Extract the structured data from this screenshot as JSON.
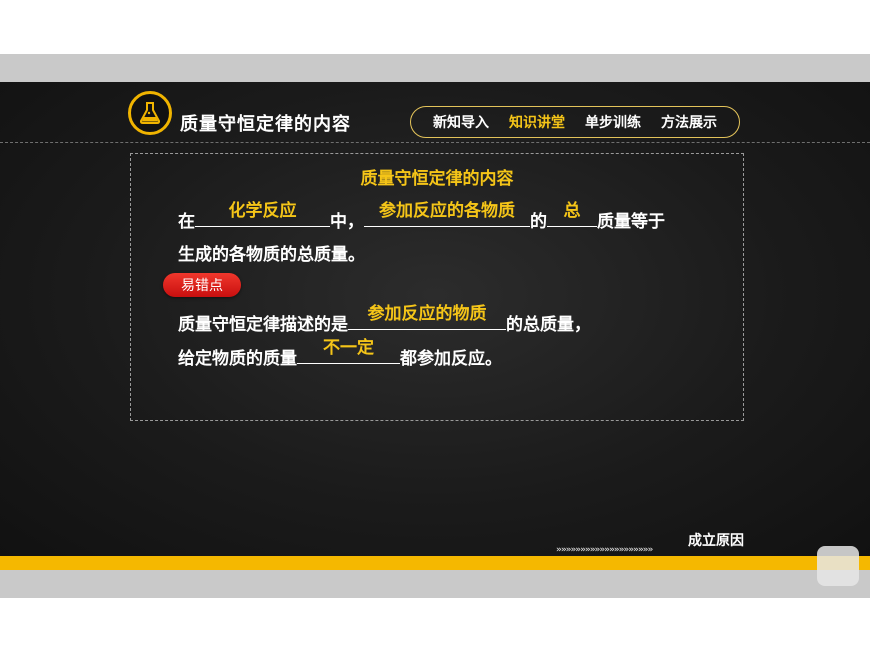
{
  "header": {
    "title": "质量守恒定律的内容",
    "logo_icon": "flask-icon"
  },
  "nav": {
    "items": [
      {
        "label": "新知导入",
        "active": false
      },
      {
        "label": "知识讲堂",
        "active": true
      },
      {
        "label": "单步训练",
        "active": false
      },
      {
        "label": "方法展示",
        "active": false
      }
    ]
  },
  "content": {
    "box_title": "质量守恒定律的内容",
    "definition": {
      "p1": "在",
      "blank1": "化学反应",
      "p2": "中，",
      "blank2": "参加反应的各物质",
      "p3": "的",
      "blank3": "总",
      "p4": "质量等于",
      "line2": "生成的各物质的总质量。"
    },
    "badge": "易错点",
    "mistake": {
      "p1": "质量守恒定律描述的是",
      "blank1": "参加反应的物质",
      "p2": "的总质量，",
      "p3": "给定物质的质量",
      "blank2": "不一定",
      "p4": "都参加反应。"
    }
  },
  "footer": {
    "link": "成立原因",
    "chevrons": "»»»»»»»»»»»»»»»»»»»»"
  },
  "colors": {
    "accent": "#f5c518",
    "badge": "#e02020",
    "yellow_bar": "#f5b800"
  }
}
